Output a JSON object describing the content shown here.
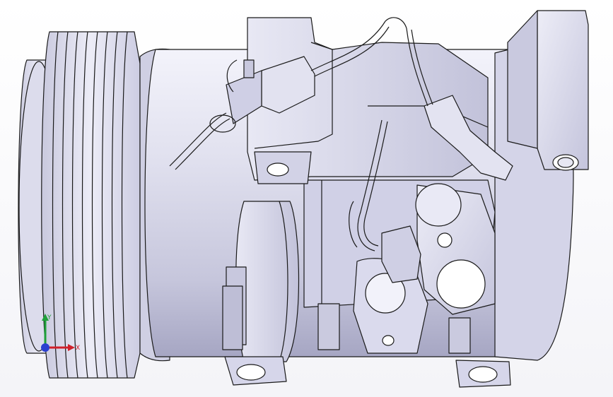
{
  "viewport": {
    "triad": {
      "x_label": "X",
      "y_label": "Y"
    }
  },
  "colors": {
    "body": "#d6d6e8",
    "body_dark": "#a9a9c6",
    "body_light": "#f2f2fb",
    "edge": "#1a1a1a",
    "x_axis": "#d0202a",
    "y_axis": "#1fa03a",
    "z_axis": "#2a3fd0"
  }
}
